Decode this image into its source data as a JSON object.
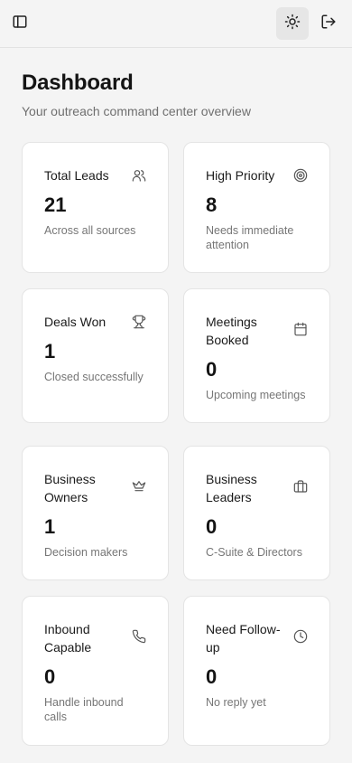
{
  "header": {
    "sidebar_icon": "sidebar-toggle-icon",
    "theme_icon": "sun-icon",
    "logout_icon": "logout-icon"
  },
  "page": {
    "title": "Dashboard",
    "subtitle": "Your outreach command center overview"
  },
  "cards": [
    {
      "title": "Total Leads",
      "value": "21",
      "desc": "Across all sources",
      "icon": "users-icon"
    },
    {
      "title": "High Priority",
      "value": "8",
      "desc": "Needs immediate attention",
      "icon": "target-icon"
    },
    {
      "title": "Deals Won",
      "value": "1",
      "desc": "Closed successfully",
      "icon": "trophy-icon"
    },
    {
      "title": "Meetings Booked",
      "value": "0",
      "desc": "Upcoming meetings",
      "icon": "calendar-icon"
    },
    {
      "title": "Business Owners",
      "value": "1",
      "desc": "Decision makers",
      "icon": "crown-icon"
    },
    {
      "title": "Business Leaders",
      "value": "0",
      "desc": "C-Suite & Directors",
      "icon": "briefcase-icon"
    },
    {
      "title": "Inbound Capable",
      "value": "0",
      "desc": "Handle inbound calls",
      "icon": "phone-icon"
    },
    {
      "title": "Need Follow-up",
      "value": "0",
      "desc": "No reply yet",
      "icon": "clock-icon"
    }
  ]
}
